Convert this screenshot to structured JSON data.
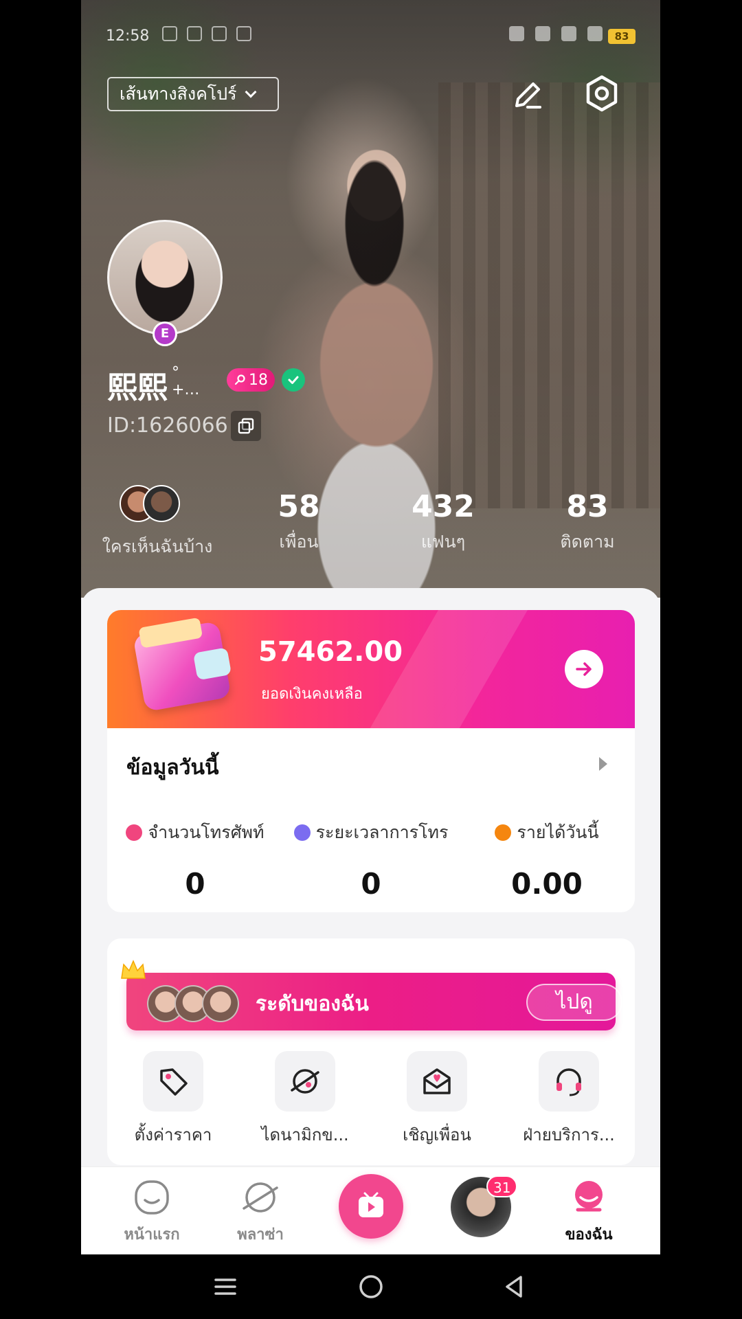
{
  "status_bar": {
    "time": "12:58",
    "battery": "83"
  },
  "header": {
    "route_label": "เส้นทางสิงคโปร์"
  },
  "profile": {
    "username": "熙熙",
    "username_suffix": "°",
    "username_ellipsis": "+…",
    "level_badge": "18",
    "avatar_badge": "E",
    "user_id": "ID:1626066"
  },
  "stats": {
    "visitors_label": "ใครเห็นฉันบ้าง",
    "friends_value": "58",
    "friends_label": "เพื่อน",
    "fans_value": "432",
    "fans_label": "แฟนๆ",
    "following_value": "83",
    "following_label": "ติดตาม"
  },
  "balance": {
    "amount": "57462.00",
    "label": "ยอดเงินคงเหลือ"
  },
  "today": {
    "title": "ข้อมูลวันนี้",
    "metrics": [
      {
        "label": "จำนวนโทรศัพท์",
        "value": "0",
        "color": "#f0457e"
      },
      {
        "label": "ระยะเวลาการโทร",
        "value": "0",
        "color": "#7b6cf0"
      },
      {
        "label": "รายได้วันนี้",
        "value": "0.00",
        "color": "#f5860f"
      }
    ]
  },
  "level": {
    "title": "ระดับของฉัน",
    "button": "ไปดู"
  },
  "tools": [
    {
      "label": "ตั้งค่าราคา",
      "icon": "price-tag-icon"
    },
    {
      "label": "ไดนามิกข...",
      "icon": "planet-icon"
    },
    {
      "label": "เชิญเพื่อน",
      "icon": "invite-mail-icon"
    },
    {
      "label": "ฝ่ายบริการ...",
      "icon": "headset-icon"
    }
  ],
  "bottom_nav": {
    "home": "หน้าแรก",
    "plaza": "พลาซ่า",
    "me": "ของฉัน",
    "msg_badge": "31"
  },
  "colors": {
    "brand_pink": "#f2478e",
    "balance_gradient_start": "#ff7c2a",
    "balance_gradient_end": "#e81fb0",
    "verified_green": "#19c37d"
  }
}
